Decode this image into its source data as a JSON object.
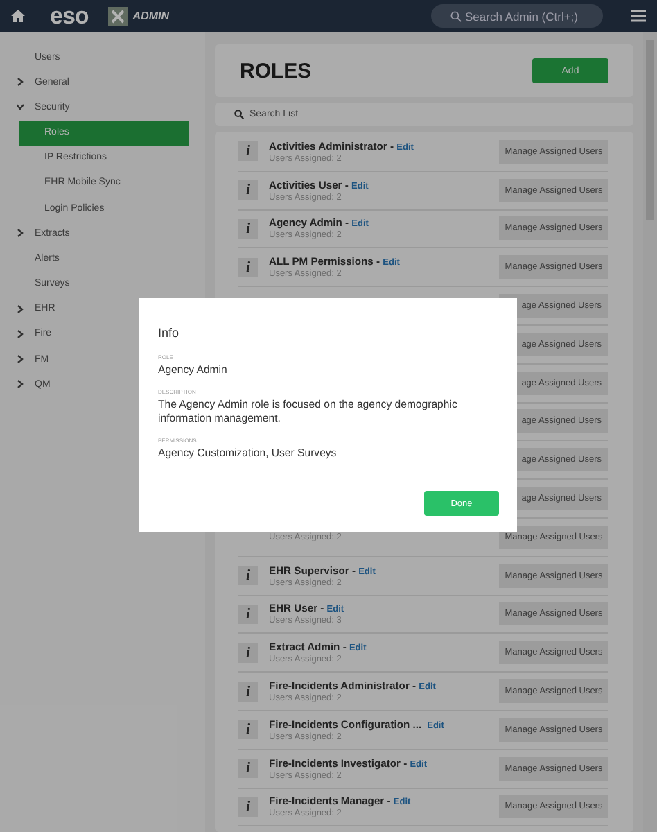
{
  "header": {
    "logo": "eso",
    "app_name": "ADMIN",
    "search": {
      "placeholder": "Search Admin (Ctrl+;)"
    }
  },
  "sidebar": {
    "items": [
      {
        "label": "Users",
        "expandable": false,
        "selected": false
      },
      {
        "label": "General",
        "expandable": true,
        "expanded": false,
        "selected": false
      },
      {
        "label": "Security",
        "expandable": true,
        "expanded": true,
        "selected": false,
        "children": [
          {
            "label": "Roles",
            "selected": true
          },
          {
            "label": "IP Restrictions",
            "selected": false
          },
          {
            "label": "EHR Mobile Sync",
            "selected": false
          },
          {
            "label": "Login Policies",
            "selected": false
          }
        ]
      },
      {
        "label": "Extracts",
        "expandable": true,
        "expanded": false,
        "selected": false
      },
      {
        "label": "Alerts",
        "expandable": false,
        "selected": false
      },
      {
        "label": "Surveys",
        "expandable": false,
        "selected": false
      },
      {
        "label": "EHR",
        "expandable": true,
        "expanded": false,
        "selected": false
      },
      {
        "label": "Fire",
        "expandable": true,
        "expanded": false,
        "selected": false
      },
      {
        "label": "FM",
        "expandable": true,
        "expanded": false,
        "selected": false
      },
      {
        "label": "QM",
        "expandable": true,
        "expanded": false,
        "selected": false
      }
    ]
  },
  "page": {
    "title": "ROLES",
    "add_button": "Add",
    "search": {
      "placeholder": "Search List"
    }
  },
  "roles": [
    {
      "info": "i",
      "name": "Activities Administrator",
      "separator": " - ",
      "edit": "Edit",
      "users": "Users Assigned: 2",
      "button": "Manage Assigned Users"
    },
    {
      "info": "i",
      "name": "Activities User",
      "separator": " - ",
      "edit": "Edit",
      "users": "Users Assigned: 2",
      "button": "Manage Assigned Users"
    },
    {
      "info": "i",
      "name": "Agency Admin",
      "separator": " - ",
      "edit": "Edit",
      "users": "Users Assigned: 2",
      "button": "Manage Assigned Users"
    },
    {
      "info": "i",
      "name": "ALL PM Permissions",
      "separator": " - ",
      "edit": "Edit",
      "users": "Users Assigned: 2",
      "button": "Manage Assigned Users"
    },
    {
      "button": "age Assigned Users"
    },
    {
      "button": "age Assigned Users"
    },
    {
      "button": "age Assigned Users"
    },
    {
      "button": "age Assigned Users"
    },
    {
      "button": "age Assigned Users"
    },
    {
      "button": "age Assigned Users"
    },
    {
      "users": "Users Assigned: 2",
      "button": "Manage Assigned Users"
    },
    {
      "info": "i",
      "name": "EHR Supervisor",
      "separator": " - ",
      "edit": "Edit",
      "users": "Users Assigned: 2",
      "button": "Manage Assigned Users"
    },
    {
      "info": "i",
      "name": "EHR User",
      "separator": " - ",
      "edit": "Edit",
      "users": "Users Assigned: 3",
      "button": "Manage Assigned Users"
    },
    {
      "info": "i",
      "name": "Extract Admin",
      "separator": " - ",
      "edit": "Edit",
      "users": "Users Assigned: 2",
      "button": "Manage Assigned Users"
    },
    {
      "info": "i",
      "name": "Fire-Incidents Administrator",
      "separator": " - ",
      "edit": "Edit",
      "users": "Users Assigned: 2",
      "button": "Manage Assigned Users"
    },
    {
      "info": "i",
      "name": "Fire-Incidents Configuration ...",
      "edit": "Edit",
      "users": "Users Assigned: 2",
      "button": "Manage Assigned Users"
    },
    {
      "info": "i",
      "name": "Fire-Incidents Investigator",
      "separator": " - ",
      "edit": "Edit",
      "users": "Users Assigned: 2",
      "button": "Manage Assigned Users"
    },
    {
      "info": "i",
      "name": "Fire-Incidents Manager",
      "separator": " - ",
      "edit": "Edit",
      "users": "Users Assigned: 2",
      "button": "Manage Assigned Users"
    }
  ],
  "dialog": {
    "title": "Info",
    "fields": [
      {
        "label": "ROLE",
        "value": "Agency Admin"
      },
      {
        "label": "DESCRIPTION",
        "value": "The Agency Admin role is focused on the agency demographic information management."
      },
      {
        "label": "PERMISSIONS",
        "value": "Agency Customization, User Surveys"
      }
    ],
    "button": "Done"
  }
}
